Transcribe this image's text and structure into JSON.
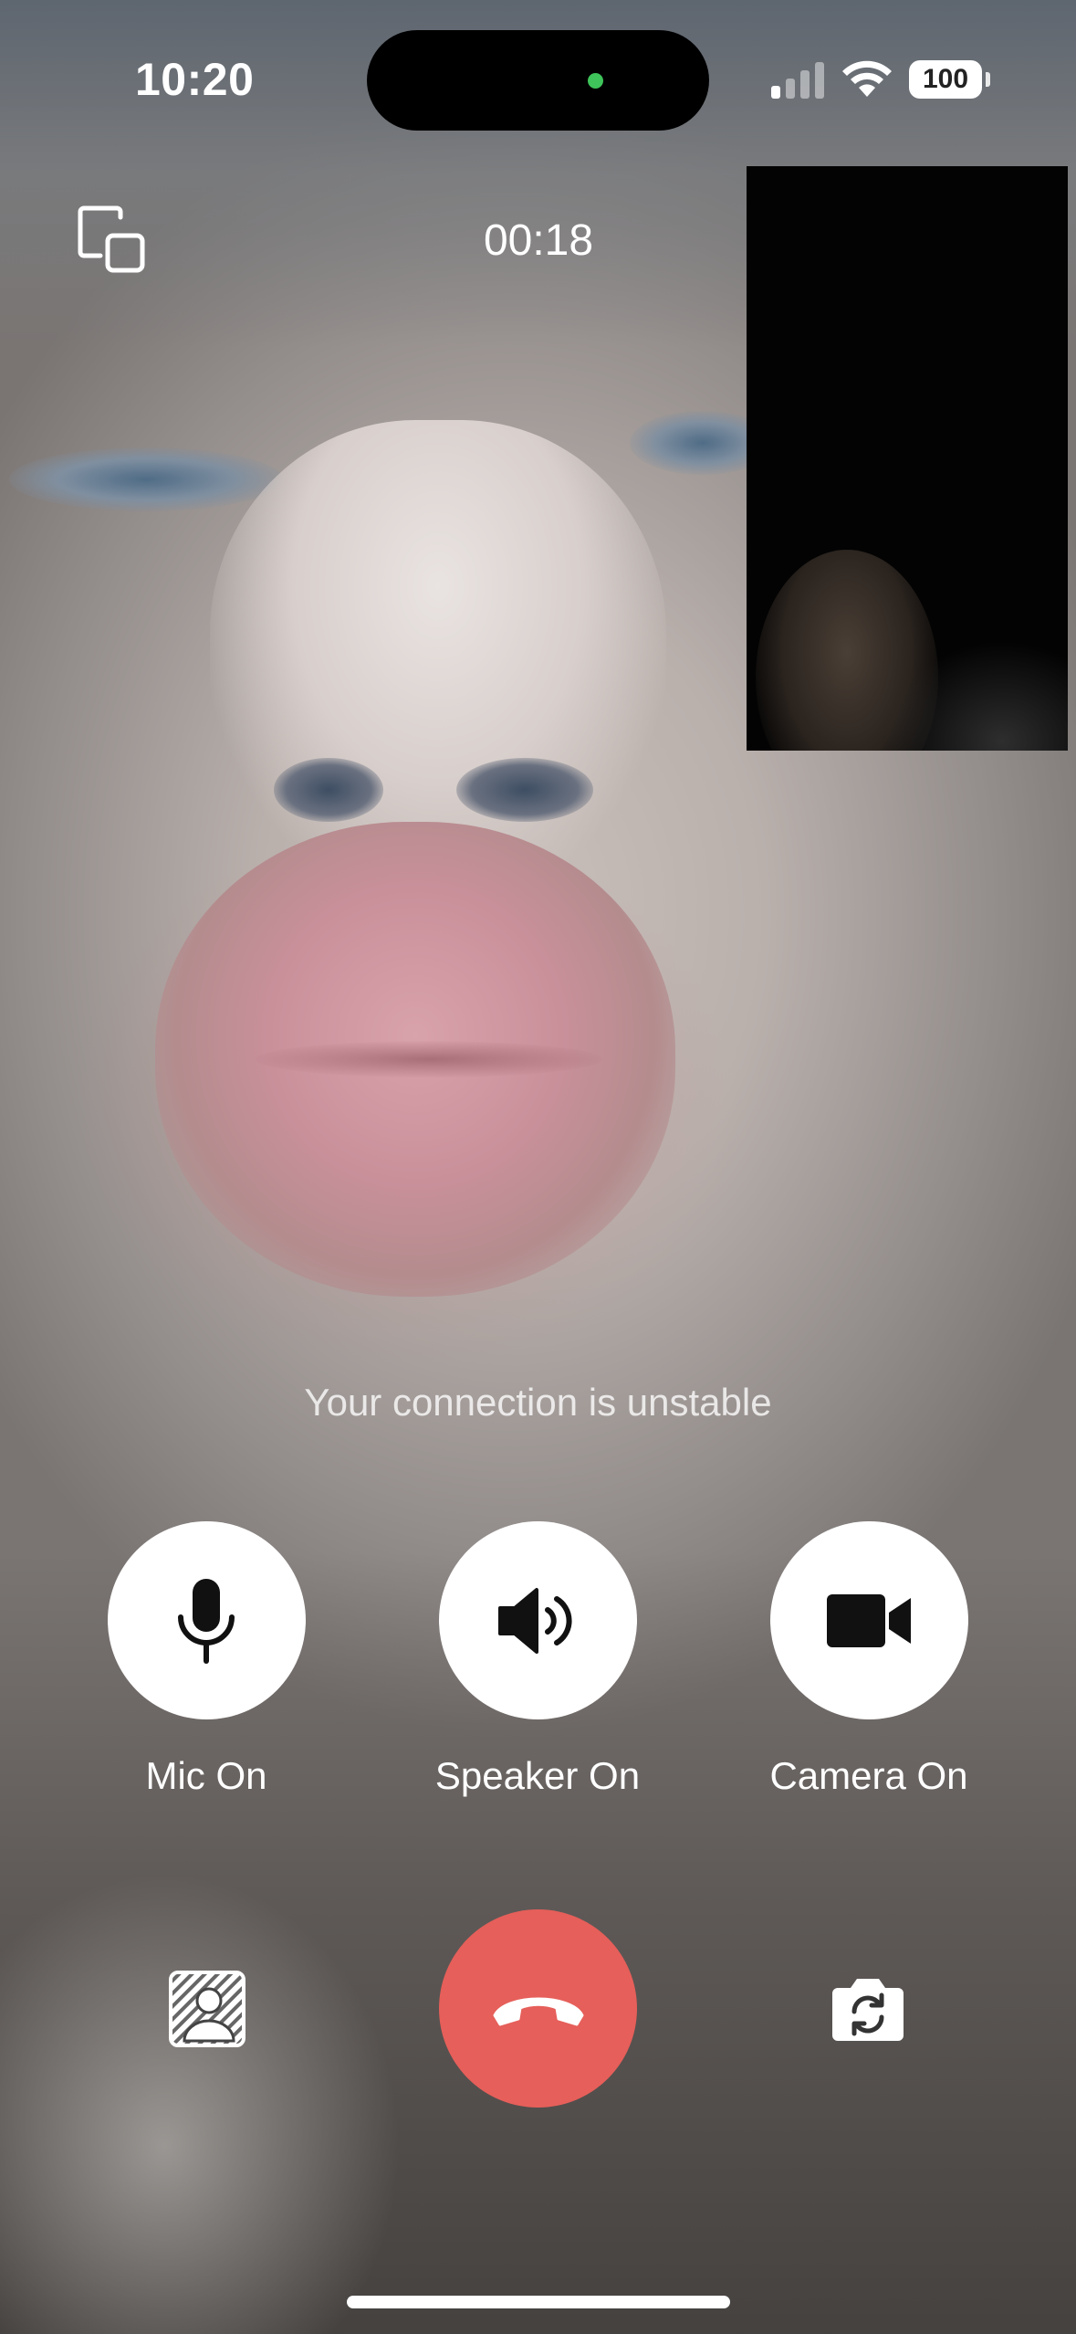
{
  "status_bar": {
    "time": "10:20",
    "battery": "100",
    "icons": [
      "signal-icon",
      "wifi-icon",
      "battery-icon"
    ]
  },
  "call": {
    "timer": "00:18",
    "connection_message": "Your connection is unstable"
  },
  "controls": {
    "mic_label": "Mic On",
    "speaker_label": "Speaker On",
    "camera_label": "Camera On"
  },
  "bottom_actions": {
    "left": "background-blur-icon",
    "center": "end-call-icon",
    "right": "flip-camera-icon"
  },
  "colors": {
    "end_call": "#e65f5a",
    "control_bg": "#ffffff",
    "mic_indicator": "#3ec45a"
  }
}
